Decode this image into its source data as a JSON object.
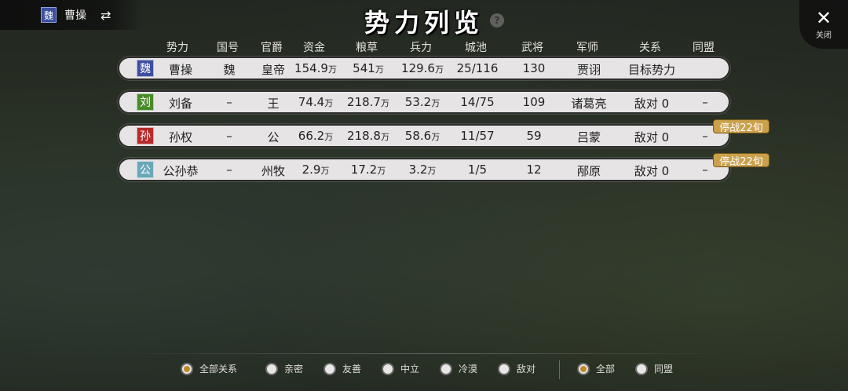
{
  "player": {
    "flag": "魏",
    "name": "曹操",
    "swap_icon": "⇄"
  },
  "title": "势力列览",
  "help_label": "?",
  "close": {
    "icon": "✕",
    "label": "关闭"
  },
  "columns": [
    "势力",
    "国号",
    "官爵",
    "资金",
    "粮草",
    "兵力",
    "城池",
    "武将",
    "军师",
    "关系",
    "同盟"
  ],
  "rows": [
    {
      "flag": "魏",
      "flag_color": "#3c4fa0",
      "name": "曹操",
      "country": "魏",
      "rank": "皇帝",
      "funds": "154.9",
      "food": "541",
      "troops": "129.6",
      "cities": "25/116",
      "generals": "130",
      "advisor": "贾诩",
      "relation": "目标势力",
      "alliance": "",
      "truce": ""
    },
    {
      "flag": "刘",
      "flag_color": "#4a8a2a",
      "name": "刘备",
      "country": "–",
      "rank": "王",
      "funds": "74.4",
      "food": "218.7",
      "troops": "53.2",
      "cities": "14/75",
      "generals": "109",
      "advisor": "诸葛亮",
      "relation": "敌对 0",
      "alliance": "–",
      "truce": ""
    },
    {
      "flag": "孙",
      "flag_color": "#b82a2a",
      "name": "孙权",
      "country": "–",
      "rank": "公",
      "funds": "66.2",
      "food": "218.8",
      "troops": "58.6",
      "cities": "11/57",
      "generals": "59",
      "advisor": "吕蒙",
      "relation": "敌对 0",
      "alliance": "–",
      "truce": "停战22旬"
    },
    {
      "flag": "公",
      "flag_color": "#6aa8b8",
      "name": "公孙恭",
      "country": "–",
      "rank": "州牧",
      "funds": "2.9",
      "food": "17.2",
      "troops": "3.2",
      "cities": "1/5",
      "generals": "12",
      "advisor": "邴原",
      "relation": "敌对 0",
      "alliance": "–",
      "truce": "停战22旬"
    }
  ],
  "unit": "万",
  "filters": {
    "relation": [
      {
        "label": "全部关系",
        "selected": true
      },
      {
        "label": "亲密",
        "selected": false
      },
      {
        "label": "友善",
        "selected": false
      },
      {
        "label": "中立",
        "selected": false
      },
      {
        "label": "冷漠",
        "selected": false
      },
      {
        "label": "敌对",
        "selected": false
      }
    ],
    "alliance": [
      {
        "label": "全部",
        "selected": true
      },
      {
        "label": "同盟",
        "selected": false
      }
    ]
  }
}
